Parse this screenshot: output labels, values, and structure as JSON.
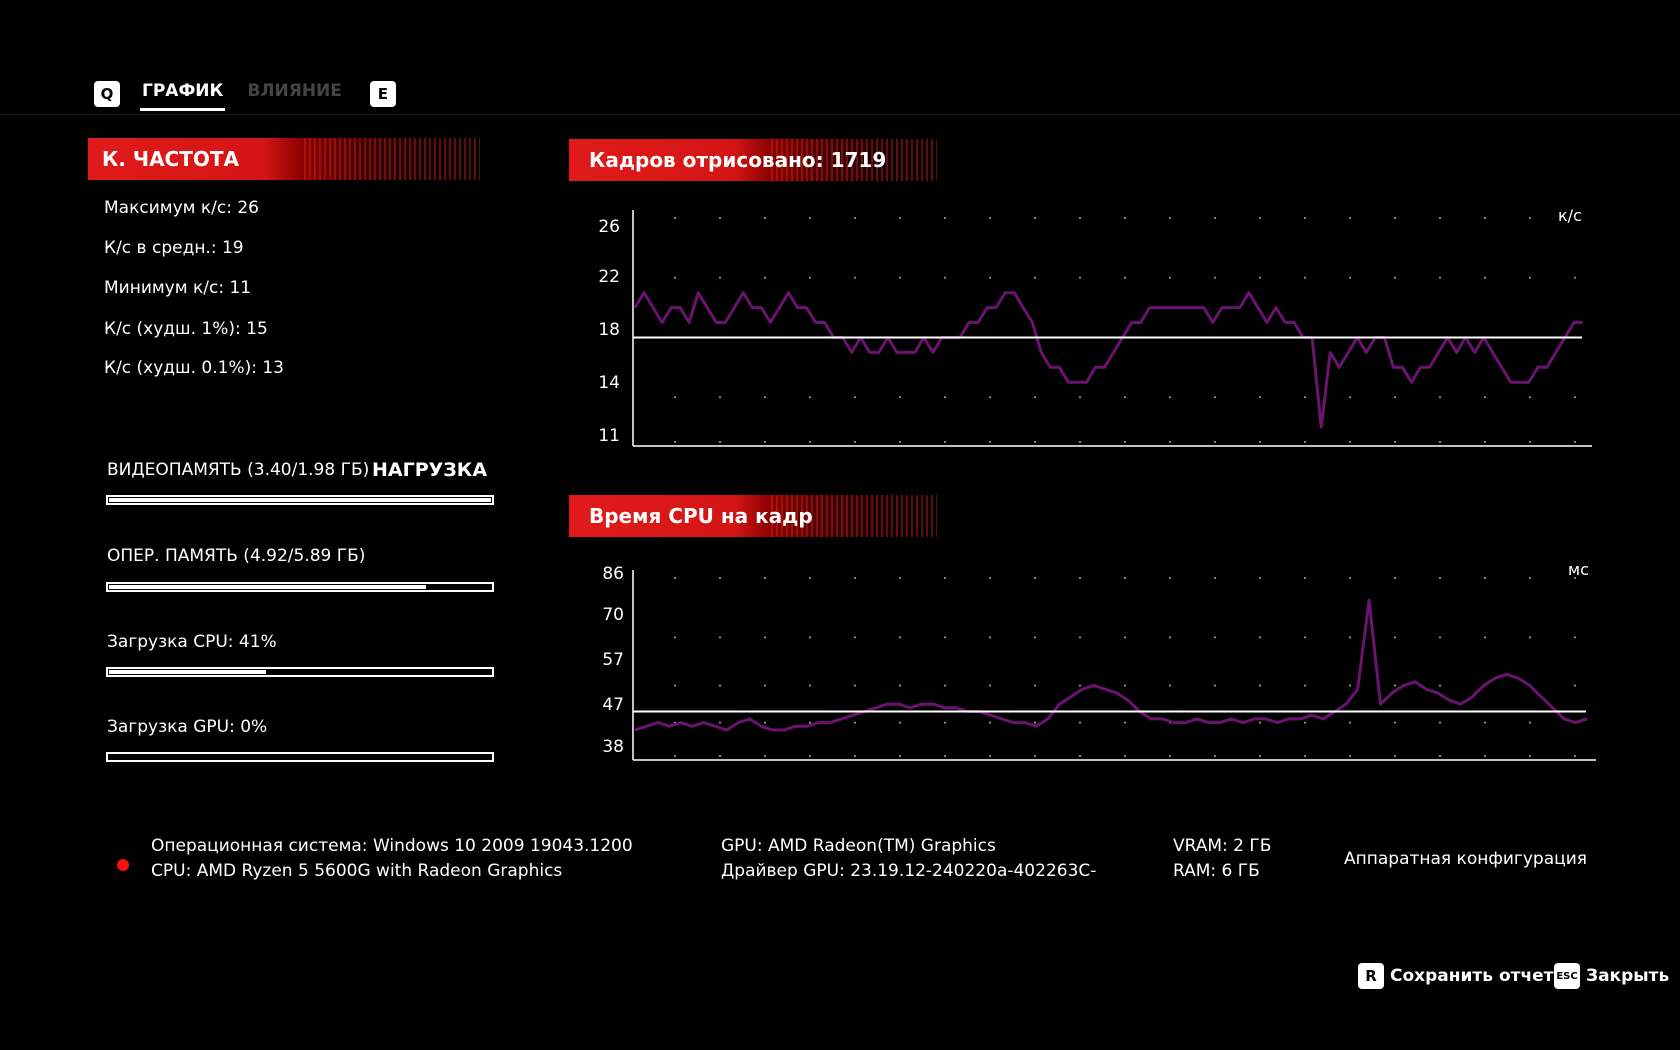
{
  "tabs": {
    "left_key": "Q",
    "right_key": "E",
    "items": [
      {
        "label": "ГРАФИК",
        "active": true
      },
      {
        "label": "ВЛИЯНИЕ",
        "active": false
      }
    ]
  },
  "fps_panel": {
    "title": "К. ЧАСТОТА",
    "stats": [
      "Максимум к/с: 26",
      "К/с в средн.: 19",
      "Минимум к/с: 11",
      "К/с (худш. 1%): 15",
      "К/с (худш. 0.1%): 13"
    ]
  },
  "load_panel": {
    "title": "НАГРУЗКА",
    "meters": [
      {
        "label": "ВИДЕОПАМЯТЬ (3.40/1.98 ГБ)",
        "fill": 1.0
      },
      {
        "label": "ОПЕР. ПАМЯТЬ (4.92/5.89 ГБ)",
        "fill": 0.83
      },
      {
        "label": "Загрузка CPU: 41%",
        "fill": 0.41
      },
      {
        "label": "Загрузка GPU: 0%",
        "fill": 0.0
      }
    ]
  },
  "chart_data": [
    {
      "type": "line",
      "title": "Кадров отрисовано: 1719",
      "unit": "к/с",
      "yticks": [
        26,
        22,
        18,
        14,
        11
      ],
      "ylim": [
        11,
        26
      ],
      "average_line": 18,
      "series_color": "#6a1470",
      "series": [
        {
          "values": [
            20,
            21,
            20,
            19,
            20,
            20,
            19,
            21,
            20,
            19,
            19,
            20,
            21,
            20,
            20,
            19,
            20,
            21,
            20,
            20,
            19,
            19,
            18,
            18,
            17,
            18,
            17,
            17,
            18,
            17,
            17,
            17,
            18,
            17,
            18,
            18,
            18,
            19,
            19,
            20,
            20,
            21,
            21,
            20,
            19,
            17,
            16,
            16,
            15,
            15,
            15,
            16,
            16,
            17,
            18,
            19,
            19,
            20,
            20,
            20,
            20,
            20,
            20,
            20,
            19,
            20,
            20,
            20,
            21,
            20,
            19,
            20,
            19,
            19,
            18,
            18,
            12,
            17,
            16,
            17,
            18,
            17,
            18,
            18,
            16,
            16,
            15,
            16,
            16,
            17,
            18,
            17,
            18,
            17,
            18,
            17,
            16,
            15,
            15,
            15,
            16,
            16,
            17,
            18,
            19,
            19
          ]
        }
      ]
    },
    {
      "type": "line",
      "title": "Время CPU на кадр",
      "unit": "мс",
      "yticks": [
        86,
        70,
        57,
        47,
        38
      ],
      "ylim": [
        38,
        86
      ],
      "average_line": 50,
      "series_color": "#6a1470",
      "series": [
        {
          "values": [
            45,
            46,
            47,
            46,
            47,
            46,
            47,
            46,
            45,
            47,
            48,
            46,
            45,
            45,
            46,
            46,
            47,
            47,
            48,
            49,
            50,
            51,
            52,
            52,
            51,
            52,
            52,
            51,
            51,
            50,
            50,
            49,
            48,
            47,
            47,
            46,
            48,
            52,
            54,
            56,
            57,
            56,
            55,
            53,
            50,
            48,
            48,
            47,
            47,
            48,
            47,
            47,
            48,
            47,
            48,
            48,
            47,
            48,
            48,
            49,
            48,
            50,
            52,
            56,
            80,
            52,
            55,
            57,
            58,
            56,
            55,
            53,
            52,
            54,
            57,
            59,
            60,
            59,
            57,
            54,
            51,
            48,
            47,
            48
          ]
        }
      ]
    }
  ],
  "system": {
    "os": "Операционная система: Windows 10 2009 19043.1200",
    "cpu": "CPU: AMD Ryzen 5 5600G with Radeon Graphics",
    "gpu": "GPU: AMD Radeon(TM) Graphics",
    "driver": "Драйвер GPU: 23.19.12-240220a-402263C-",
    "vram": "VRAM: 2 ГБ",
    "ram": "RAM: 6 ГБ",
    "hw_config": "Аппаратная конфигурация"
  },
  "footer": {
    "save": {
      "key": "R",
      "label": "Сохранить отчет"
    },
    "close": {
      "key": "ESC",
      "label": "Закрыть"
    }
  }
}
